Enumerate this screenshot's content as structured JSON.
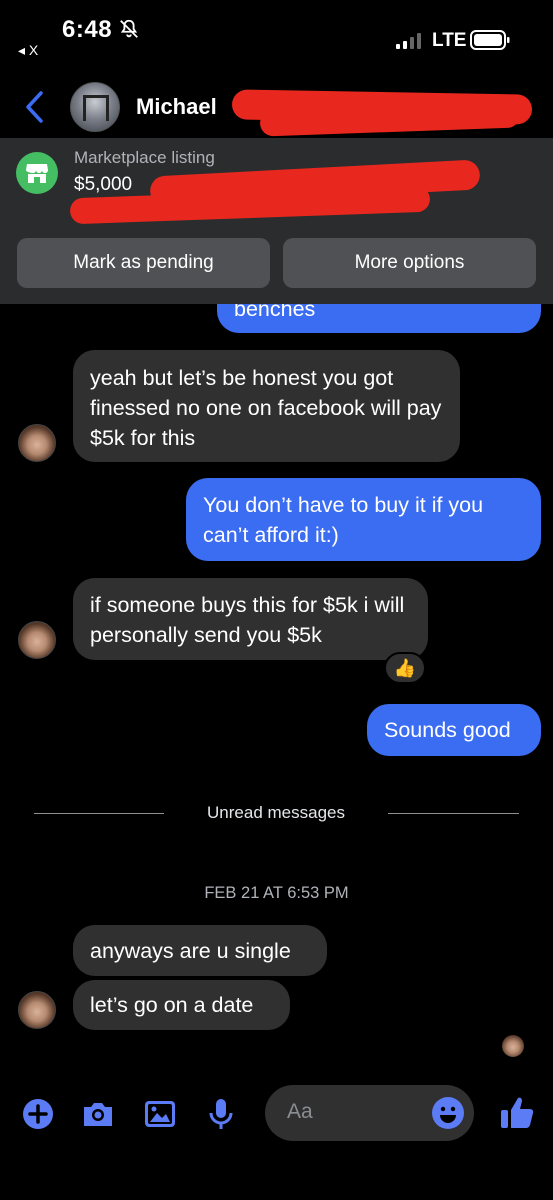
{
  "status_bar": {
    "time": "6:48",
    "back_app": "◂ X",
    "network": "LTE"
  },
  "header": {
    "contact_name": "Michael"
  },
  "listing": {
    "label": "Marketplace listing",
    "price": "$5,000",
    "pending_button": "Mark as pending",
    "more_button": "More options"
  },
  "messages": [
    {
      "direction": "outgoing",
      "text": "benches"
    },
    {
      "direction": "incoming",
      "text": "yeah but let’s be honest you got finessed no one on facebook will pay $5k for this"
    },
    {
      "direction": "outgoing",
      "text": "You don’t have to buy it if you can’t afford it:)"
    },
    {
      "direction": "incoming",
      "text": "if someone buys this for $5k i will personally send you $5k",
      "reaction": "👍"
    },
    {
      "direction": "outgoing",
      "text": "Sounds good"
    }
  ],
  "unread_divider": "Unread messages",
  "timestamp": "FEB 21 AT 6:53 PM",
  "new_messages": [
    {
      "direction": "incoming",
      "text": "anyways are u single"
    },
    {
      "direction": "incoming",
      "text": "let’s go on a date"
    }
  ],
  "composer": {
    "placeholder": "Aa"
  },
  "colors": {
    "accent": "#3b6df2",
    "incoming_bubble": "#303030",
    "panel": "#2b2c2e",
    "marketplace_green": "#45bd62",
    "redaction": "#e8281e",
    "icon": "#5b7cf5"
  },
  "icons": [
    "bell-slash-icon",
    "signal-icon",
    "battery-icon",
    "back-chevron-icon",
    "store-icon",
    "plus-icon",
    "camera-icon",
    "image-icon",
    "microphone-icon",
    "emoji-icon",
    "thumbs-up-icon"
  ]
}
